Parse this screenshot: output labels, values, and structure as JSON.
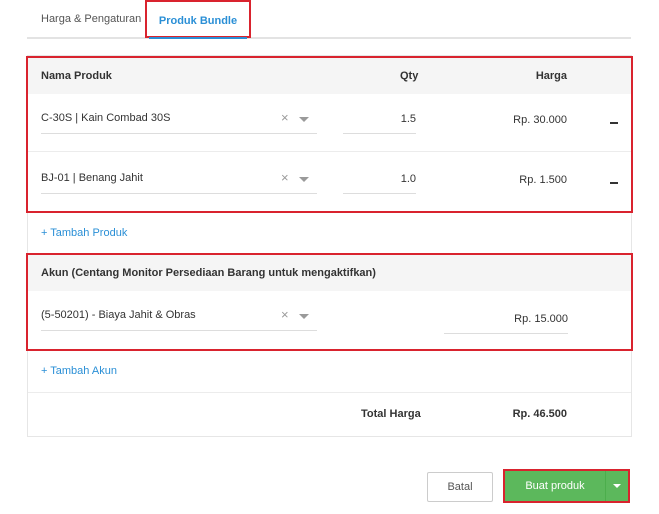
{
  "tabs": {
    "pricing_label": "Harga & Pengaturan",
    "bundle_label": "Produk Bundle"
  },
  "products_table": {
    "headers": {
      "product": "Nama Produk",
      "qty": "Qty",
      "price": "Harga"
    },
    "rows": [
      {
        "product": "C-30S | Kain Combad 30S",
        "qty": "1.5",
        "price": "Rp. 30.000"
      },
      {
        "product": "BJ-01 | Benang Jahit",
        "qty": "1.0",
        "price": "Rp. 1.500"
      }
    ],
    "add_label": "+ Tambah Produk"
  },
  "account_table": {
    "header": "Akun (Centang Monitor Persediaan Barang untuk mengaktifkan)",
    "row": {
      "account": "(5-50201) - Biaya Jahit & Obras",
      "price": "Rp. 15.000"
    },
    "add_label": "+ Tambah Akun"
  },
  "total": {
    "label": "Total Harga",
    "value": "Rp. 46.500"
  },
  "actions": {
    "cancel_label": "Batal",
    "create_label": "Buat produk"
  },
  "icons": {
    "clear": "clear-icon",
    "dropdown": "chevron-down-icon",
    "remove": "minus-icon"
  },
  "colors": {
    "accent": "#2a8fd6",
    "primary_button": "#5cb85c",
    "highlight_border": "#d9232e"
  }
}
